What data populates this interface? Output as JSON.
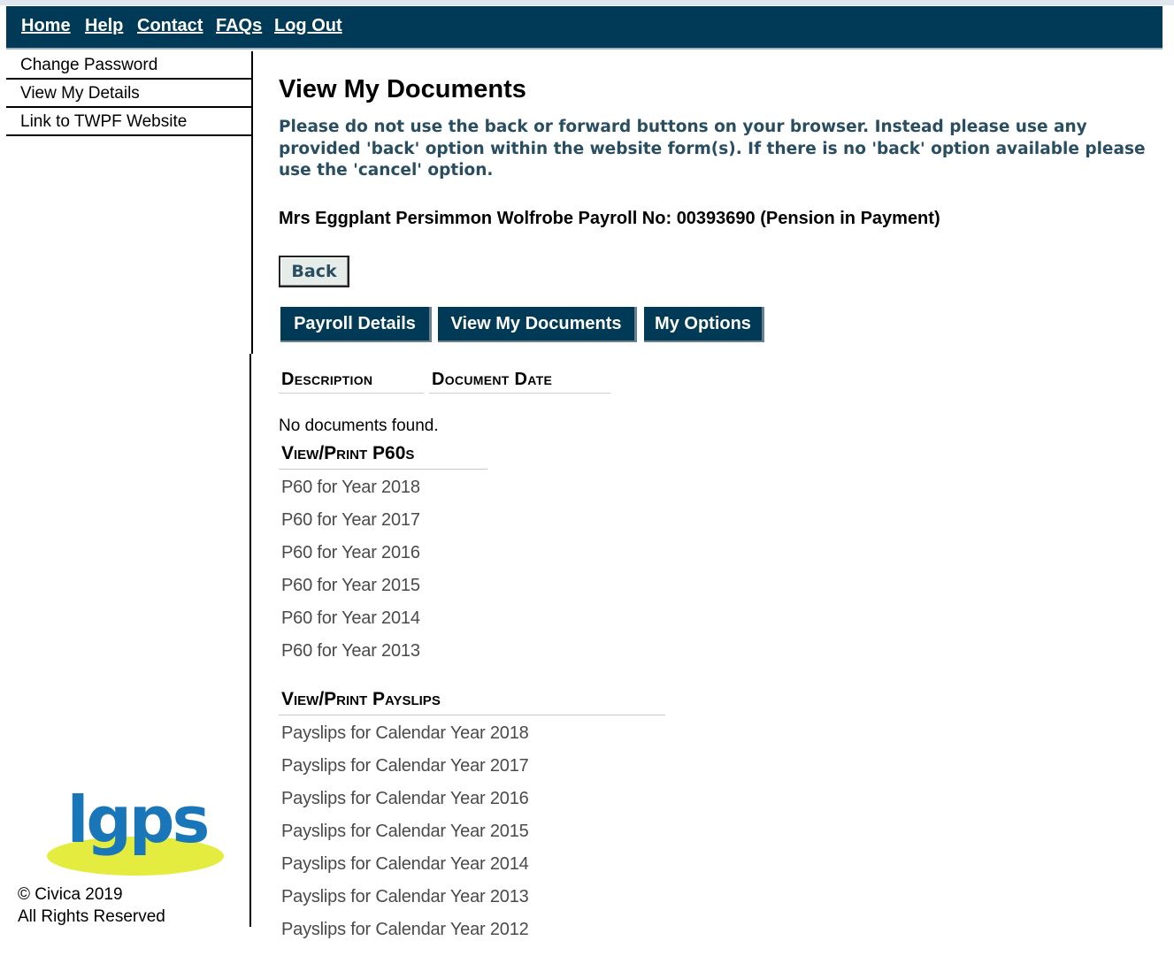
{
  "topnav": {
    "links": [
      {
        "label": "Home"
      },
      {
        "label": "Help"
      },
      {
        "label": "Contact"
      },
      {
        "label": "FAQs"
      },
      {
        "label": "Log Out"
      }
    ]
  },
  "sidebar": {
    "items": [
      {
        "label": "Change Password"
      },
      {
        "label": "View My Details"
      },
      {
        "label": "Link to TWPF Website"
      }
    ],
    "logo_text": "lgps",
    "copyright_line1": "© Civica 2019",
    "copyright_line2": "All Rights Reserved"
  },
  "main": {
    "title": "View My Documents",
    "notice": "Please do not use the back or forward buttons on your browser. Instead please use any provided 'back' option within the website form(s). If there is no 'back' option available please use the 'cancel' option.",
    "member_line": "Mrs Eggplant Persimmon Wolfrobe Payroll No: 00393690 (Pension in Payment)",
    "back_label": "Back",
    "tabs": [
      {
        "label": "Payroll Details"
      },
      {
        "label": "View My Documents"
      },
      {
        "label": "My Options"
      }
    ],
    "columns": {
      "description": "Description",
      "document_date": "Document Date"
    },
    "no_documents": "No documents found.",
    "p60": {
      "heading": "View/Print P60s",
      "links": [
        "P60 for Year 2018",
        "P60 for Year 2017",
        "P60 for Year 2016",
        "P60 for Year 2015",
        "P60 for Year 2014",
        "P60 for Year 2013"
      ]
    },
    "payslips": {
      "heading": "View/Print Payslips",
      "links": [
        "Payslips for Calendar Year 2018",
        "Payslips for Calendar Year 2017",
        "Payslips for Calendar Year 2016",
        "Payslips for Calendar Year 2015",
        "Payslips for Calendar Year 2014",
        "Payslips for Calendar Year 2013",
        "Payslips for Calendar Year 2012"
      ]
    }
  },
  "colors": {
    "nav_bg": "#003a56",
    "notice_text": "#294e61",
    "logo_blue": "#1976b8",
    "logo_yellow": "#e3ec3f"
  }
}
